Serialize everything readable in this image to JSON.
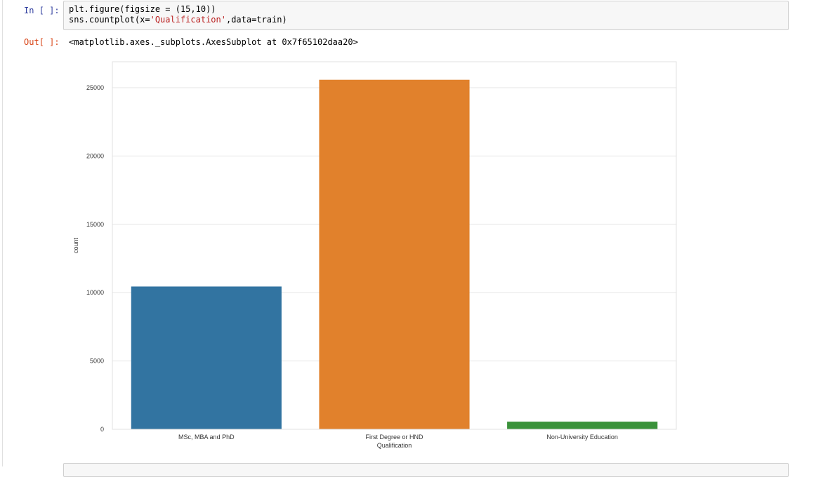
{
  "cell_in": {
    "prompt": "In [ ]:",
    "code_line1": "plt.figure(figsize = (15,10))",
    "code_line2_prefix": "sns.countplot(x=",
    "code_line2_string": "'Qualification'",
    "code_line2_suffix": ",data=train)"
  },
  "cell_out": {
    "prompt": "Out[ ]:",
    "text": "<matplotlib.axes._subplots.AxesSubplot at 0x7f65102daa20>"
  },
  "chart_data": {
    "type": "bar",
    "categories": [
      "MSc, MBA and PhD",
      "First Degree or HND",
      "Non-University Education"
    ],
    "values": [
      10450,
      25580,
      560
    ],
    "colors": [
      "#3274a1",
      "#e1812c",
      "#3a923a"
    ],
    "xlabel": "Qualification",
    "ylabel": "count",
    "ylim": [
      0,
      26900
    ],
    "yticks": [
      0,
      5000,
      10000,
      15000,
      20000,
      25000
    ],
    "ytick_labels": [
      "0",
      "5000",
      "10000",
      "15000",
      "20000",
      "25000"
    ],
    "grid": true
  }
}
